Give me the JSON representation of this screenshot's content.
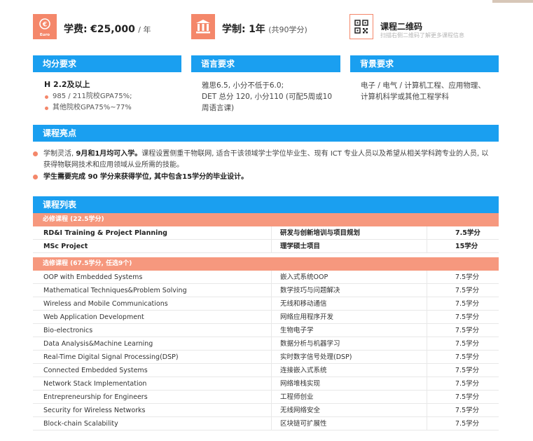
{
  "info": {
    "tuition": {
      "icon": "euro-coin-icon",
      "icon_text": "Euro",
      "label": "学费:",
      "value": "€25,000",
      "suffix": "/ 年"
    },
    "duration": {
      "icon": "institution-icon",
      "label": "学制:",
      "value": "1年",
      "suffix": "(共90学分)"
    },
    "qr": {
      "icon": "qr-code-icon",
      "title": "课程二维码",
      "subtitle": "扫描右侧二维码了解更多课程信息"
    }
  },
  "requirements": {
    "gpa": {
      "header": "均分要求",
      "main": "H 2.2及以上",
      "items": [
        "985 / 211院校GPA75%;",
        "其他院校GPA75%~77%"
      ]
    },
    "language": {
      "header": "语言要求",
      "lines": [
        "雅思6.5, 小分不低于6.0;",
        "DET 总分 120, 小分110 (可配5周或10",
        "周语言课)"
      ]
    },
    "background": {
      "header": "背景要求",
      "lines": [
        "电子 / 电气 / 计算机工程、应用物理、",
        "计算机科学或其他工程学科"
      ]
    }
  },
  "highlights": {
    "header": "课程亮点",
    "p1_pre": "学制灵活, ",
    "p1_bold": "9月和1月均可入学。",
    "p1_post": "课程设置侧重干物联网, 适合干该领域学士学位毕业生、现有 ICT 专业人员以及希望从相关学科跨专业的人员, 以获得物联网技术和应用领域从业所需的技能。",
    "p2": "学生需要完成 90 学分来获得学位, 其中包含15学分的毕业设计。"
  },
  "courses": {
    "header": "课程列表",
    "required_header": "必修课程 (22.5学分)",
    "required": [
      {
        "en": "RD&I Training & Project Planning",
        "zh": "研发与创新培训与项目规划",
        "credits": "7.5学分"
      },
      {
        "en": "MSc Project",
        "zh": "理学硕士项目",
        "credits": "15学分"
      }
    ],
    "elective_header": "选修课程 (67.5学分, 任选9个)",
    "electives": [
      {
        "en": "OOP with Embedded Systems",
        "zh": "嵌入式系统OOP",
        "credits": "7.5学分"
      },
      {
        "en": "Mathematical Techniques&Problem Solving",
        "zh": "数学技巧与问题解决",
        "credits": "7.5学分"
      },
      {
        "en": "Wireless and Mobile Communications",
        "zh": "无线和移动通信",
        "credits": "7.5学分"
      },
      {
        "en": "Web Application Development",
        "zh": "网络应用程序开发",
        "credits": "7.5学分"
      },
      {
        "en": "Bio-electronics",
        "zh": "生物电子学",
        "credits": "7.5学分"
      },
      {
        "en": "Data Analysis&Machine Learning",
        "zh": "数据分析与机器学习",
        "credits": "7.5学分"
      },
      {
        "en": "Real-Time Digital Signal Processing(DSP)",
        "zh": "实时数字信号处理(DSP)",
        "credits": "7.5学分"
      },
      {
        "en": "Connected Embedded Systems",
        "zh": "连接嵌入式系统",
        "credits": "7.5学分"
      },
      {
        "en": "Network Stack Implementation",
        "zh": "网络堆栈实现",
        "credits": "7.5学分"
      },
      {
        "en": "Entrepreneurship for Engineers",
        "zh": "工程师创业",
        "credits": "7.5学分"
      },
      {
        "en": "Security for Wireless Networks",
        "zh": "无线网络安全",
        "credits": "7.5学分"
      },
      {
        "en": "Block-chain Scalability",
        "zh": "区块链可扩展性",
        "credits": "7.5学分"
      }
    ]
  },
  "colors": {
    "accent_blue": "#1a9ff0",
    "accent_orange": "#f4876a",
    "row_orange": "#f6987e"
  }
}
